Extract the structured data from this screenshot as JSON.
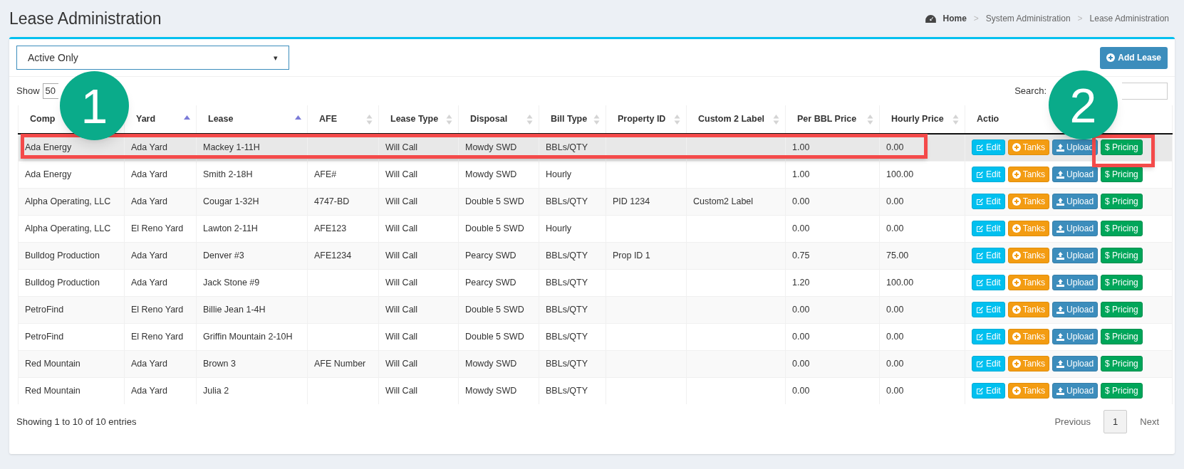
{
  "page_title": "Lease Administration",
  "breadcrumb": {
    "separator": ">",
    "items": [
      {
        "label": "Home"
      },
      {
        "label": "System Administration"
      },
      {
        "label": "Lease Administration"
      }
    ]
  },
  "filter": {
    "value": "Active Only",
    "caret": "▾"
  },
  "add_button": "Add Lease",
  "show_label": "Show",
  "page_size": "50",
  "search_label": "Search:",
  "columns": [
    {
      "label": "Comp"
    },
    {
      "label": "Yard",
      "sorted": true
    },
    {
      "label": "Lease",
      "sorted": true
    },
    {
      "label": "AFE",
      "sorted": false
    },
    {
      "label": "Lease Type",
      "sorted": false
    },
    {
      "label": "Disposal",
      "sorted": false
    },
    {
      "label": "Bill Type",
      "sorted": false
    },
    {
      "label": "Property ID",
      "sorted": false
    },
    {
      "label": "Custom 2 Label",
      "sorted": false
    },
    {
      "label": "Per BBL Price",
      "sorted": false
    },
    {
      "label": "Hourly Price",
      "sorted": false
    },
    {
      "label": "Actio"
    }
  ],
  "rows": [
    {
      "hovered": true,
      "cells": [
        "Ada Energy",
        "Ada Yard",
        "Mackey 1-11H",
        "",
        "Will Call",
        "Mowdy SWD",
        "BBLs/QTY",
        "",
        "",
        "1.00",
        "0.00"
      ],
      "actions": [
        "Edit",
        "Tanks",
        "Upload",
        "$ Pricing"
      ]
    },
    {
      "hovered": false,
      "cells": [
        "Ada Energy",
        "Ada Yard",
        "Smith 2-18H",
        "AFE#",
        "Will Call",
        "Mowdy SWD",
        "Hourly",
        "",
        "",
        "1.00",
        "100.00"
      ],
      "actions": [
        "Edit",
        "Tanks",
        "Upload",
        "$ Pricing"
      ]
    },
    {
      "hovered": false,
      "cells": [
        "Alpha Operating, LLC",
        "Ada Yard",
        "Cougar 1-32H",
        "4747-BD",
        "Will Call",
        "Double 5 SWD",
        "BBLs/QTY",
        "PID 1234",
        "Custom2 Label",
        "0.00",
        "0.00"
      ],
      "actions": [
        "Edit",
        "Tanks",
        "Upload",
        "$ Pricing"
      ]
    },
    {
      "hovered": false,
      "cells": [
        "Alpha Operating, LLC",
        "El Reno Yard",
        "Lawton 2-11H",
        "AFE123",
        "Will Call",
        "Double 5 SWD",
        "Hourly",
        "",
        "",
        "0.00",
        "0.00"
      ],
      "actions": [
        "Edit",
        "Tanks",
        "Upload",
        "$ Pricing"
      ]
    },
    {
      "hovered": false,
      "cells": [
        "Bulldog Production",
        "Ada Yard",
        "Denver #3",
        "AFE1234",
        "Will Call",
        "Pearcy SWD",
        "BBLs/QTY",
        "Prop ID 1",
        "",
        "0.75",
        "75.00"
      ],
      "actions": [
        "Edit",
        "Tanks",
        "Upload",
        "$ Pricing"
      ]
    },
    {
      "hovered": false,
      "cells": [
        "Bulldog Production",
        "Ada Yard",
        "Jack Stone #9",
        "",
        "Will Call",
        "Pearcy SWD",
        "BBLs/QTY",
        "",
        "",
        "1.20",
        "100.00"
      ],
      "actions": [
        "Edit",
        "Tanks",
        "Upload",
        "$ Pricing"
      ]
    },
    {
      "hovered": false,
      "cells": [
        "PetroFind",
        "El Reno Yard",
        "Billie Jean 1-4H",
        "",
        "Will Call",
        "Double 5 SWD",
        "BBLs/QTY",
        "",
        "",
        "0.00",
        "0.00"
      ],
      "actions": [
        "Edit",
        "Tanks",
        "Upload",
        "$ Pricing"
      ]
    },
    {
      "hovered": false,
      "cells": [
        "PetroFind",
        "El Reno Yard",
        "Griffin Mountain 2-10H",
        "",
        "Will Call",
        "Double 5 SWD",
        "BBLs/QTY",
        "",
        "",
        "0.00",
        "0.00"
      ],
      "actions": [
        "Edit",
        "Tanks",
        "Upload",
        "$ Pricing"
      ]
    },
    {
      "hovered": false,
      "cells": [
        "Red Mountain",
        "Ada Yard",
        "Brown 3",
        "AFE Number",
        "Will Call",
        "Mowdy SWD",
        "BBLs/QTY",
        "",
        "",
        "0.00",
        "0.00"
      ],
      "actions": [
        "Edit",
        "Tanks",
        "Upload",
        "$ Pricing"
      ]
    },
    {
      "hovered": false,
      "cells": [
        "Red Mountain",
        "Ada Yard",
        "Julia 2",
        "",
        "Will Call",
        "Mowdy SWD",
        "BBLs/QTY",
        "",
        "",
        "0.00",
        "0.00"
      ],
      "actions": [
        "Edit",
        "Tanks",
        "Upload",
        "$ Pricing"
      ]
    }
  ],
  "info": "Showing 1 to 10 of 10 entries",
  "pagination": [
    {
      "label": "Previous",
      "selected": false
    },
    {
      "label": "1",
      "selected": true
    },
    {
      "label": "Next",
      "selected": false
    }
  ],
  "callouts": [
    {
      "label": "1"
    },
    {
      "label": "2"
    }
  ]
}
